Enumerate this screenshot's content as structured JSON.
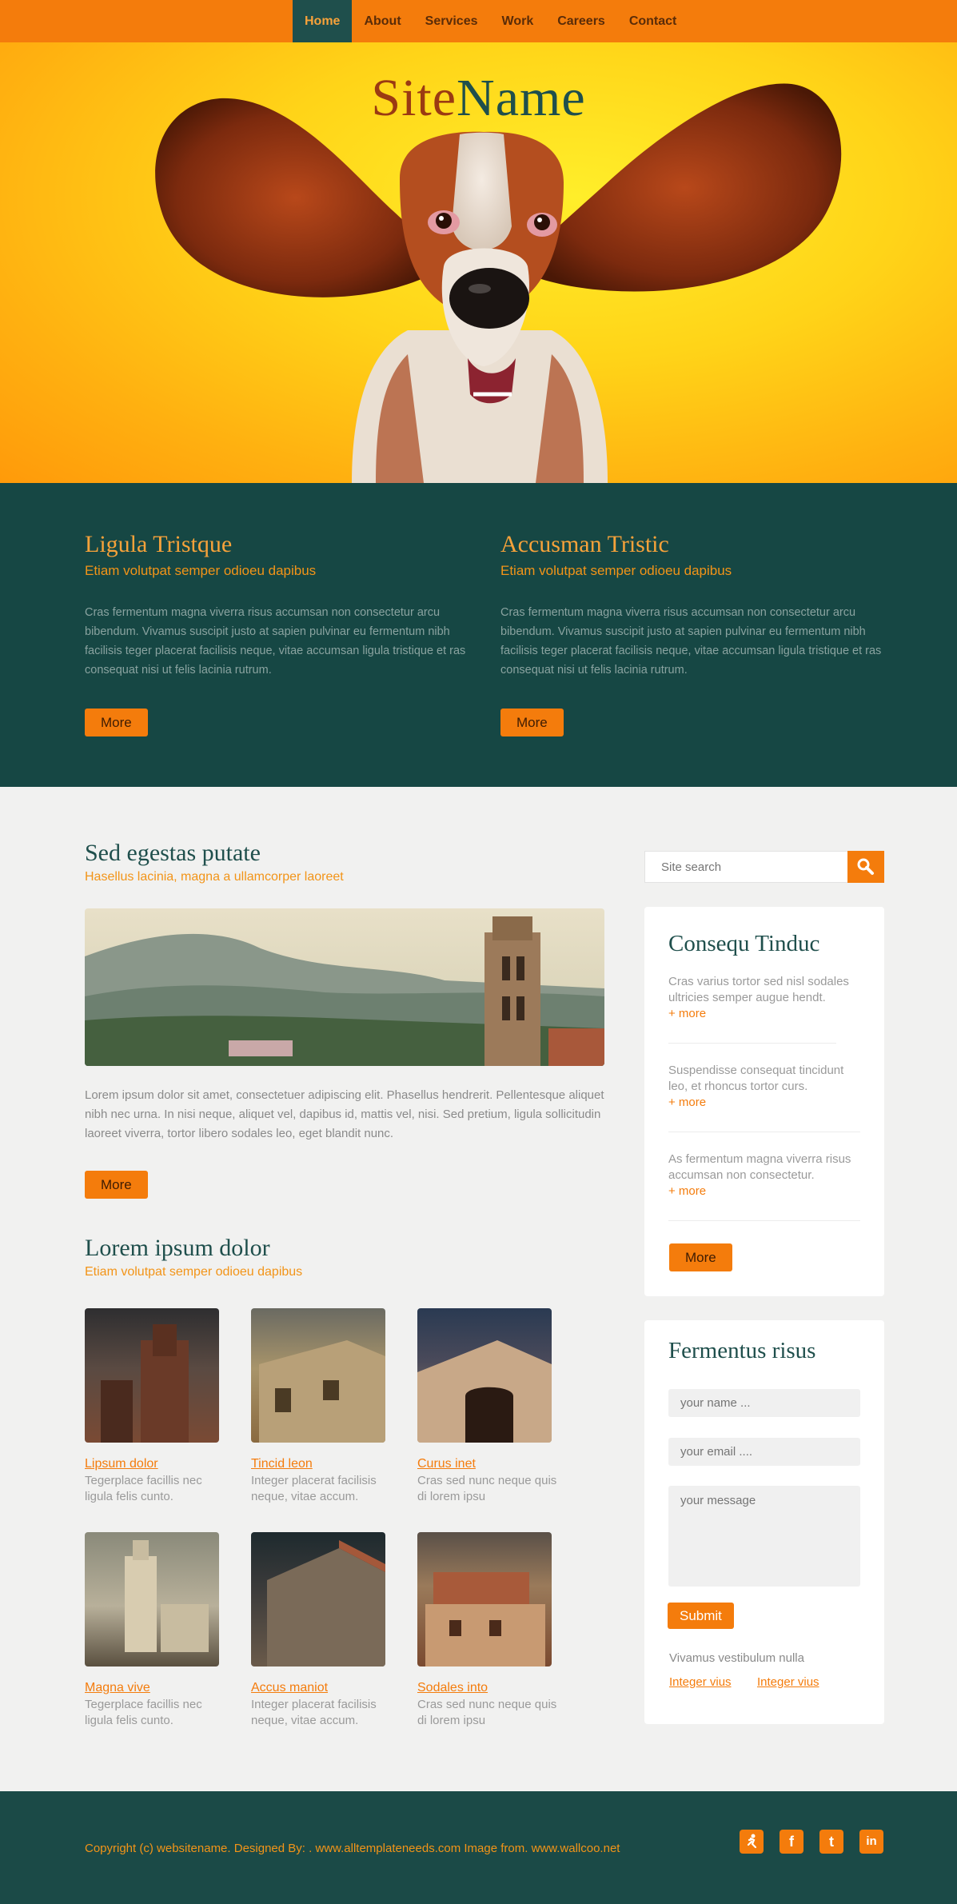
{
  "nav": {
    "items": [
      {
        "label": "Home",
        "active": true
      },
      {
        "label": "About"
      },
      {
        "label": "Services"
      },
      {
        "label": "Work"
      },
      {
        "label": "Careers"
      },
      {
        "label": "Contact"
      }
    ]
  },
  "hero": {
    "name_part1": "Site",
    "name_part2": "Name"
  },
  "features": [
    {
      "title": "Ligula Tristque",
      "subtitle": "Etiam volutpat semper odioeu dapibus",
      "text": "Cras fermentum magna viverra risus accumsan non consectetur arcu bibendum. Vivamus suscipit justo at sapien pulvinar eu fermentum nibh facilisis teger placerat facilisis neque, vitae accumsan ligula tristique et ras consequat nisi ut felis lacinia rutrum.",
      "button": "More"
    },
    {
      "title": "Accusman Tristic",
      "subtitle": "Etiam volutpat semper odioeu dapibus",
      "text": "Cras fermentum magna viverra risus accumsan non consectetur arcu bibendum. Vivamus suscipit justo at sapien pulvinar eu fermentum nibh facilisis teger placerat facilisis neque, vitae accumsan ligula tristique et ras consequat nisi ut felis lacinia rutrum.",
      "button": "More"
    }
  ],
  "article": {
    "title": "Sed egestas putate",
    "subtitle": "Hasellus lacinia, magna a ullamcorper laoreet",
    "text": "Lorem ipsum dolor sit amet, consectetuer adipiscing elit. Phasellus hendrerit. Pellentesque aliquet nibh nec urna. In nisi neque, aliquet vel, dapibus id, mattis vel, nisi. Sed pretium, ligula sollicitudin laoreet viverra, tortor libero sodales leo, eget blandit nunc.",
    "button": "More"
  },
  "gallery": {
    "title": "Lorem ipsum dolor",
    "subtitle": "Etiam volutpat semper odioeu dapibus",
    "items": [
      {
        "title": "Lipsum dolor",
        "desc": "Tegerplace facillis nec ligula felis cunto."
      },
      {
        "title": "Tincid leon",
        "desc": "Integer placerat facilisis neque, vitae accum."
      },
      {
        "title": "Curus inet",
        "desc": "Cras sed nunc neque quis di lorem ipsu"
      },
      {
        "title": "Magna vive",
        "desc": "Tegerplace facillis nec ligula felis cunto."
      },
      {
        "title": "Accus maniot",
        "desc": "Integer placerat facilisis neque, vitae accum."
      },
      {
        "title": "Sodales into",
        "desc": "Cras sed nunc neque quis di lorem ipsu"
      }
    ]
  },
  "sidebar": {
    "search_placeholder": "Site search",
    "news": {
      "title": "Consequ Tinduc",
      "items": [
        {
          "text": "Cras varius tortor sed nisl sodales ultricies semper augue hendt.",
          "more": "+ more"
        },
        {
          "text": "Suspendisse consequat tincidunt leo, et rhoncus tortor curs.",
          "more": "+ more"
        },
        {
          "text": "As fermentum magna viverra risus accumsan non consectetur.",
          "more": "+ more"
        }
      ],
      "button": "More"
    },
    "contact": {
      "title": "Fermentus risus",
      "name_placeholder": "your name ...",
      "email_placeholder": "your email ....",
      "message_placeholder": "your message",
      "submit": "Submit",
      "note": "Vivamus vestibulum nulla",
      "link1": "Integer vius",
      "link2": "Integer vius"
    }
  },
  "footer": {
    "copyright": "Copyright (c) websitename. Designed By: . www.alltemplateneeds.com  Image from. www.wallcoo.net",
    "social": [
      {
        "icon": "runner-icon",
        "glyph": "✈"
      },
      {
        "icon": "facebook-icon",
        "glyph": "f"
      },
      {
        "icon": "twitter-icon",
        "glyph": "t"
      },
      {
        "icon": "linkedin-icon",
        "glyph": "in"
      }
    ]
  },
  "colors": {
    "accent": "#f47c0c",
    "dark": "#164744",
    "title": "#1f4f4c"
  }
}
